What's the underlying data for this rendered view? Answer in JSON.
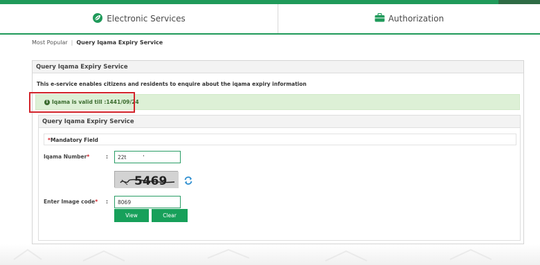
{
  "header": {
    "tabs": [
      {
        "label": "Electronic Services",
        "icon": "leaf-icon"
      },
      {
        "label": "Authorization",
        "icon": "briefcase-icon"
      }
    ]
  },
  "breadcrumb": {
    "items": [
      "Most Popular",
      "Query Iqama Expiry Service"
    ]
  },
  "panel": {
    "title": "Query Iqama Expiry Service",
    "description": "This e-service enables citizens and residents to enquire about the iqama expiry information",
    "alert": "Iqama is valid till :1441/09/24"
  },
  "service": {
    "title": "Query Iqama Expiry Service",
    "mandatory_label": "Mandatory Field",
    "iqama_label": "Iqama Number",
    "iqama_value": "22t          '",
    "captcha_text": "5469",
    "image_code_label": "Enter Image code",
    "image_code_value": "8069",
    "colon": ":",
    "required_mark": "*"
  },
  "buttons": {
    "view": "View",
    "clear": "Clear"
  },
  "colors": {
    "brand_green": "#1f9a5a",
    "button_green": "#17a05a",
    "alert_bg": "#ddf0d6",
    "highlight_red": "#d2232a"
  }
}
